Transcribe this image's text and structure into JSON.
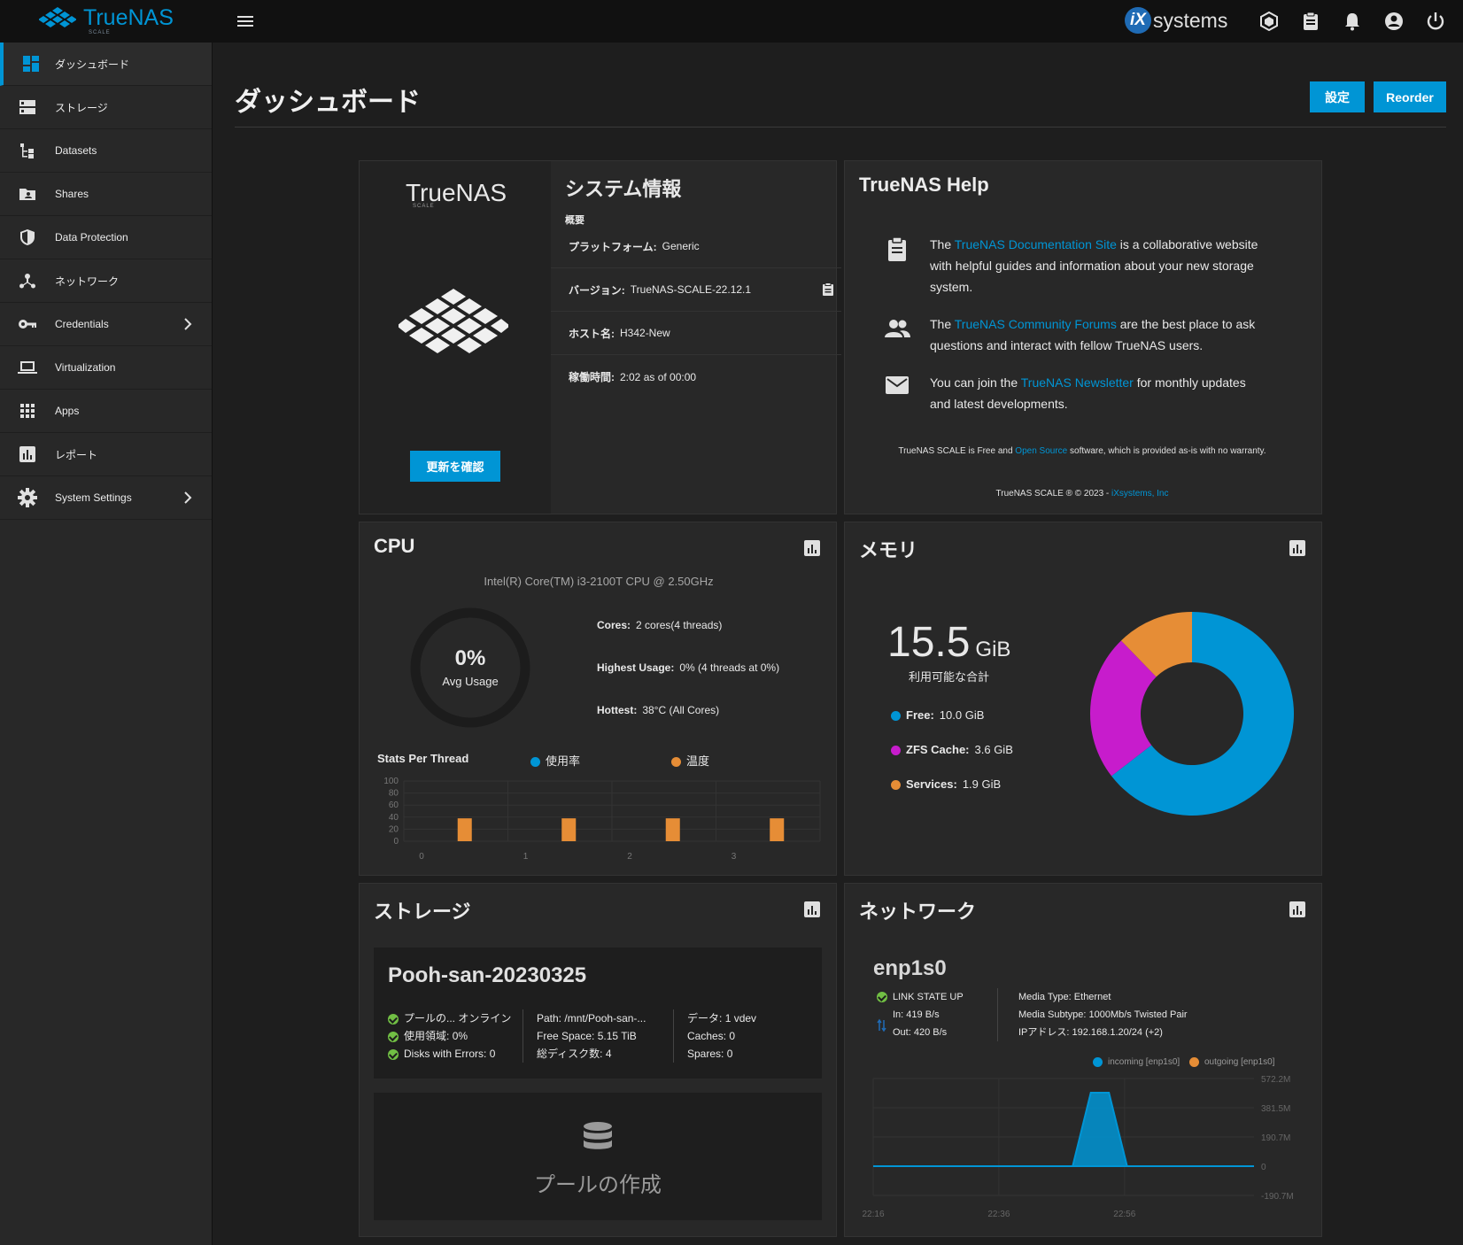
{
  "header": {
    "logo_text": "TrueNAS",
    "logo_sub": "SCALE",
    "vendor_prefix": "iX",
    "vendor_text": "systems"
  },
  "sidebar": {
    "items": [
      {
        "label": "ダッシュボード",
        "icon": "dashboard-icon",
        "active": true
      },
      {
        "label": "ストレージ",
        "icon": "storage-icon"
      },
      {
        "label": "Datasets",
        "icon": "datasets-icon"
      },
      {
        "label": "Shares",
        "icon": "shares-icon"
      },
      {
        "label": "Data Protection",
        "icon": "shield-icon"
      },
      {
        "label": "ネットワーク",
        "icon": "network-icon"
      },
      {
        "label": "Credentials",
        "icon": "key-icon",
        "has_arrow": true
      },
      {
        "label": "Virtualization",
        "icon": "laptop-icon"
      },
      {
        "label": "Apps",
        "icon": "apps-grid-icon"
      },
      {
        "label": "レポート",
        "icon": "report-icon"
      },
      {
        "label": "System Settings",
        "icon": "gear-icon",
        "has_arrow": true
      }
    ]
  },
  "page": {
    "title": "ダッシュボード",
    "configure_label": "設定",
    "reorder_label": "Reorder"
  },
  "sysinfo": {
    "logo_text": "TrueNAS",
    "logo_sub": "SCALE",
    "update_label": "更新を確認",
    "title": "システム情報",
    "overview_label": "概要",
    "platform_label": "プラットフォーム:",
    "platform_value": "Generic",
    "version_label": "バージョン:",
    "version_value": "TrueNAS-SCALE-22.12.1",
    "hostname_label": "ホスト名:",
    "hostname_value": "H342-New",
    "uptime_label": "稼働時間:",
    "uptime_value": "2:02 as of 00:00"
  },
  "help": {
    "title": "TrueNAS Help",
    "docs_pre": "The ",
    "docs_link": "TrueNAS Documentation Site",
    "docs_post": " is a collaborative website with helpful guides and information about your new storage system.",
    "forums_pre": "The ",
    "forums_link": "TrueNAS Community Forums",
    "forums_post": " are the best place to ask questions and interact with fellow TrueNAS users.",
    "news_pre": "You can join the ",
    "news_link": "TrueNAS Newsletter",
    "news_post": " for monthly updates and latest developments.",
    "foot1_pre": "TrueNAS SCALE is Free and ",
    "foot1_link": "Open Source",
    "foot1_post": " software, which is provided as-is with no warranty.",
    "foot2_pre": "TrueNAS SCALE ® © 2023 - ",
    "foot2_link": "iXsystems, Inc"
  },
  "cpu": {
    "title": "CPU",
    "model": "Intel(R) Core(TM) i3-2100T CPU @ 2.50GHz",
    "avg_value": "0%",
    "avg_label": "Avg Usage",
    "cores_label": "Cores:",
    "cores_value": "2 cores(4 threads)",
    "highest_label": "Highest Usage:",
    "highest_value": "0%  (4 threads at 0%)",
    "hottest_label": "Hottest:",
    "hottest_value": "38°C  (All Cores)",
    "stats_label": "Stats Per Thread",
    "legend_usage": "使用率",
    "legend_temp": "温度",
    "usage_color": "#0095d5",
    "temp_color": "#e68d36"
  },
  "memory": {
    "title": "メモリ",
    "total_value": "15.5",
    "total_unit": "GiB",
    "total_label": "利用可能な合計",
    "free_label": "Free:",
    "free_value": "10.0 GiB",
    "zfs_label": "ZFS Cache:",
    "zfs_value": "3.6 GiB",
    "services_label": "Services:",
    "services_value": "1.9 GiB",
    "free_color": "#0095d5",
    "zfs_color": "#c71ccc",
    "services_color": "#e68d36"
  },
  "storage": {
    "title": "ストレージ",
    "pool_name": "Pooh-san-20230325",
    "status_label": "プールの...",
    "status_value": "オンライン",
    "used_label": "使用領域:",
    "used_value": "0%",
    "errors_label": "Disks with Errors:",
    "errors_value": "0",
    "path_label": "Path:",
    "path_value": "/mnt/Pooh-san-...",
    "free_label": "Free Space:",
    "free_value": "5.15 TiB",
    "disks_label": "総ディスク数:",
    "disks_value": "4",
    "data_label": "データ:",
    "data_value": "1 vdev",
    "caches_label": "Caches:",
    "caches_value": "0",
    "spares_label": "Spares:",
    "spares_value": "0",
    "create_pool_label": "プールの作成"
  },
  "network": {
    "title": "ネットワーク",
    "iface": "enp1s0",
    "link_state": "LINK STATE UP",
    "in_label": "In:",
    "in_value": "419 B/s",
    "out_label": "Out:",
    "out_value": "420 B/s",
    "media_type_label": "Media Type:",
    "media_type_value": "Ethernet",
    "media_sub_label": "Media Subtype:",
    "media_sub_value": "1000Mb/s Twisted Pair",
    "ip_label": "IPアドレス:",
    "ip_value": "192.168.1.20/24 (+2)",
    "legend_in": "incoming [enp1s0]",
    "legend_out": "outgoing [enp1s0]",
    "in_color": "#0095d5",
    "out_color": "#e68d36"
  },
  "chart_data": [
    {
      "type": "bar",
      "title": "Stats Per Thread",
      "categories": [
        "0",
        "1",
        "2",
        "3"
      ],
      "ylim": [
        0,
        100
      ],
      "yticks": [
        "100",
        "80",
        "60",
        "40",
        "20",
        "0"
      ],
      "series": [
        {
          "name": "使用率",
          "values": [
            0,
            0,
            0,
            0
          ]
        },
        {
          "name": "温度",
          "values": [
            38,
            38,
            38,
            38
          ]
        }
      ]
    },
    {
      "type": "pie",
      "categories": [
        "Free",
        "ZFS Cache",
        "Services"
      ],
      "values": [
        10.0,
        3.6,
        1.9
      ]
    },
    {
      "type": "line",
      "x": [
        "22:16",
        "22:36",
        "22:56"
      ],
      "yticks": [
        "572.2M",
        "381.5M",
        "190.7M",
        "0",
        "-190.7M"
      ],
      "ylim": [
        -190.7,
        572.2
      ],
      "series": [
        {
          "name": "incoming [enp1s0]",
          "values": [
            0,
            0,
            0,
            0,
            0,
            0,
            0,
            0,
            0,
            0,
            0,
            0,
            480,
            480,
            0,
            0,
            0,
            0,
            0,
            0,
            0,
            0
          ]
        },
        {
          "name": "outgoing [enp1s0]",
          "values": [
            0,
            0,
            0,
            0,
            0,
            0,
            0,
            0,
            0,
            0,
            0,
            0,
            0,
            0,
            0,
            0,
            0,
            0,
            0,
            0,
            0,
            0
          ]
        }
      ]
    }
  ]
}
